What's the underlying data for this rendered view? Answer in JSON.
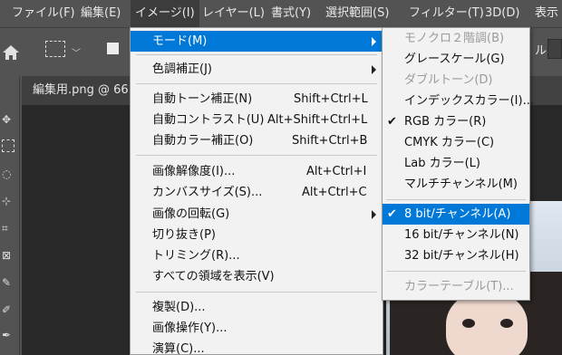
{
  "menubar": {
    "items": [
      "ファイル(F)",
      "編集(E)",
      "イメージ(I)",
      "レイヤー(L)",
      "書式(Y)",
      "選択範囲(S)",
      "フィルター(T)",
      "3D(D)",
      "表示"
    ]
  },
  "options": {
    "right_label": "ル:"
  },
  "document": {
    "tab_title": "編集用.png @ 66"
  },
  "image_menu": {
    "items": [
      {
        "label": "モード(M)",
        "shortcut": ""
      },
      {
        "label": "色調補正(J)",
        "shortcut": ""
      },
      {
        "label": "自動トーン補正(N)",
        "shortcut": "Shift+Ctrl+L"
      },
      {
        "label": "自動コントラスト(U)",
        "shortcut": "Alt+Shift+Ctrl+L"
      },
      {
        "label": "自動カラー補正(O)",
        "shortcut": "Shift+Ctrl+B"
      },
      {
        "label": "画像解像度(I)...",
        "shortcut": "Alt+Ctrl+I"
      },
      {
        "label": "カンバスサイズ(S)...",
        "shortcut": "Alt+Ctrl+C"
      },
      {
        "label": "画像の回転(G)",
        "shortcut": ""
      },
      {
        "label": "切り抜き(P)",
        "shortcut": ""
      },
      {
        "label": "トリミング(R)...",
        "shortcut": ""
      },
      {
        "label": "すべての領域を表示(V)",
        "shortcut": ""
      },
      {
        "label": "複製(D)...",
        "shortcut": ""
      },
      {
        "label": "画像操作(Y)...",
        "shortcut": ""
      },
      {
        "label": "演算(C)...",
        "shortcut": ""
      }
    ]
  },
  "mode_menu": {
    "items": [
      {
        "label": "モノクロ２階調(B)",
        "checked": false,
        "disabled": true
      },
      {
        "label": "グレースケール(G)",
        "checked": false,
        "disabled": false
      },
      {
        "label": "ダブルトーン(D)",
        "checked": false,
        "disabled": true
      },
      {
        "label": "インデックスカラー(I)...",
        "checked": false,
        "disabled": false
      },
      {
        "label": "RGB カラー(R)",
        "checked": true,
        "disabled": false
      },
      {
        "label": "CMYK カラー(C)",
        "checked": false,
        "disabled": false
      },
      {
        "label": "Lab カラー(L)",
        "checked": false,
        "disabled": false
      },
      {
        "label": "マルチチャンネル(M)",
        "checked": false,
        "disabled": false
      },
      {
        "label": "8 bit/チャンネル(A)",
        "checked": true,
        "disabled": false
      },
      {
        "label": "16 bit/チャンネル(N)",
        "checked": false,
        "disabled": false
      },
      {
        "label": "32 bit/チャンネル(H)",
        "checked": false,
        "disabled": false
      },
      {
        "label": "カラーテーブル(T)...",
        "checked": false,
        "disabled": true
      }
    ],
    "check_glyph": "✔"
  },
  "colors": {
    "highlight": "#0078d7",
    "menu_bg": "#f2f2f2",
    "app_bg": "#535353"
  }
}
